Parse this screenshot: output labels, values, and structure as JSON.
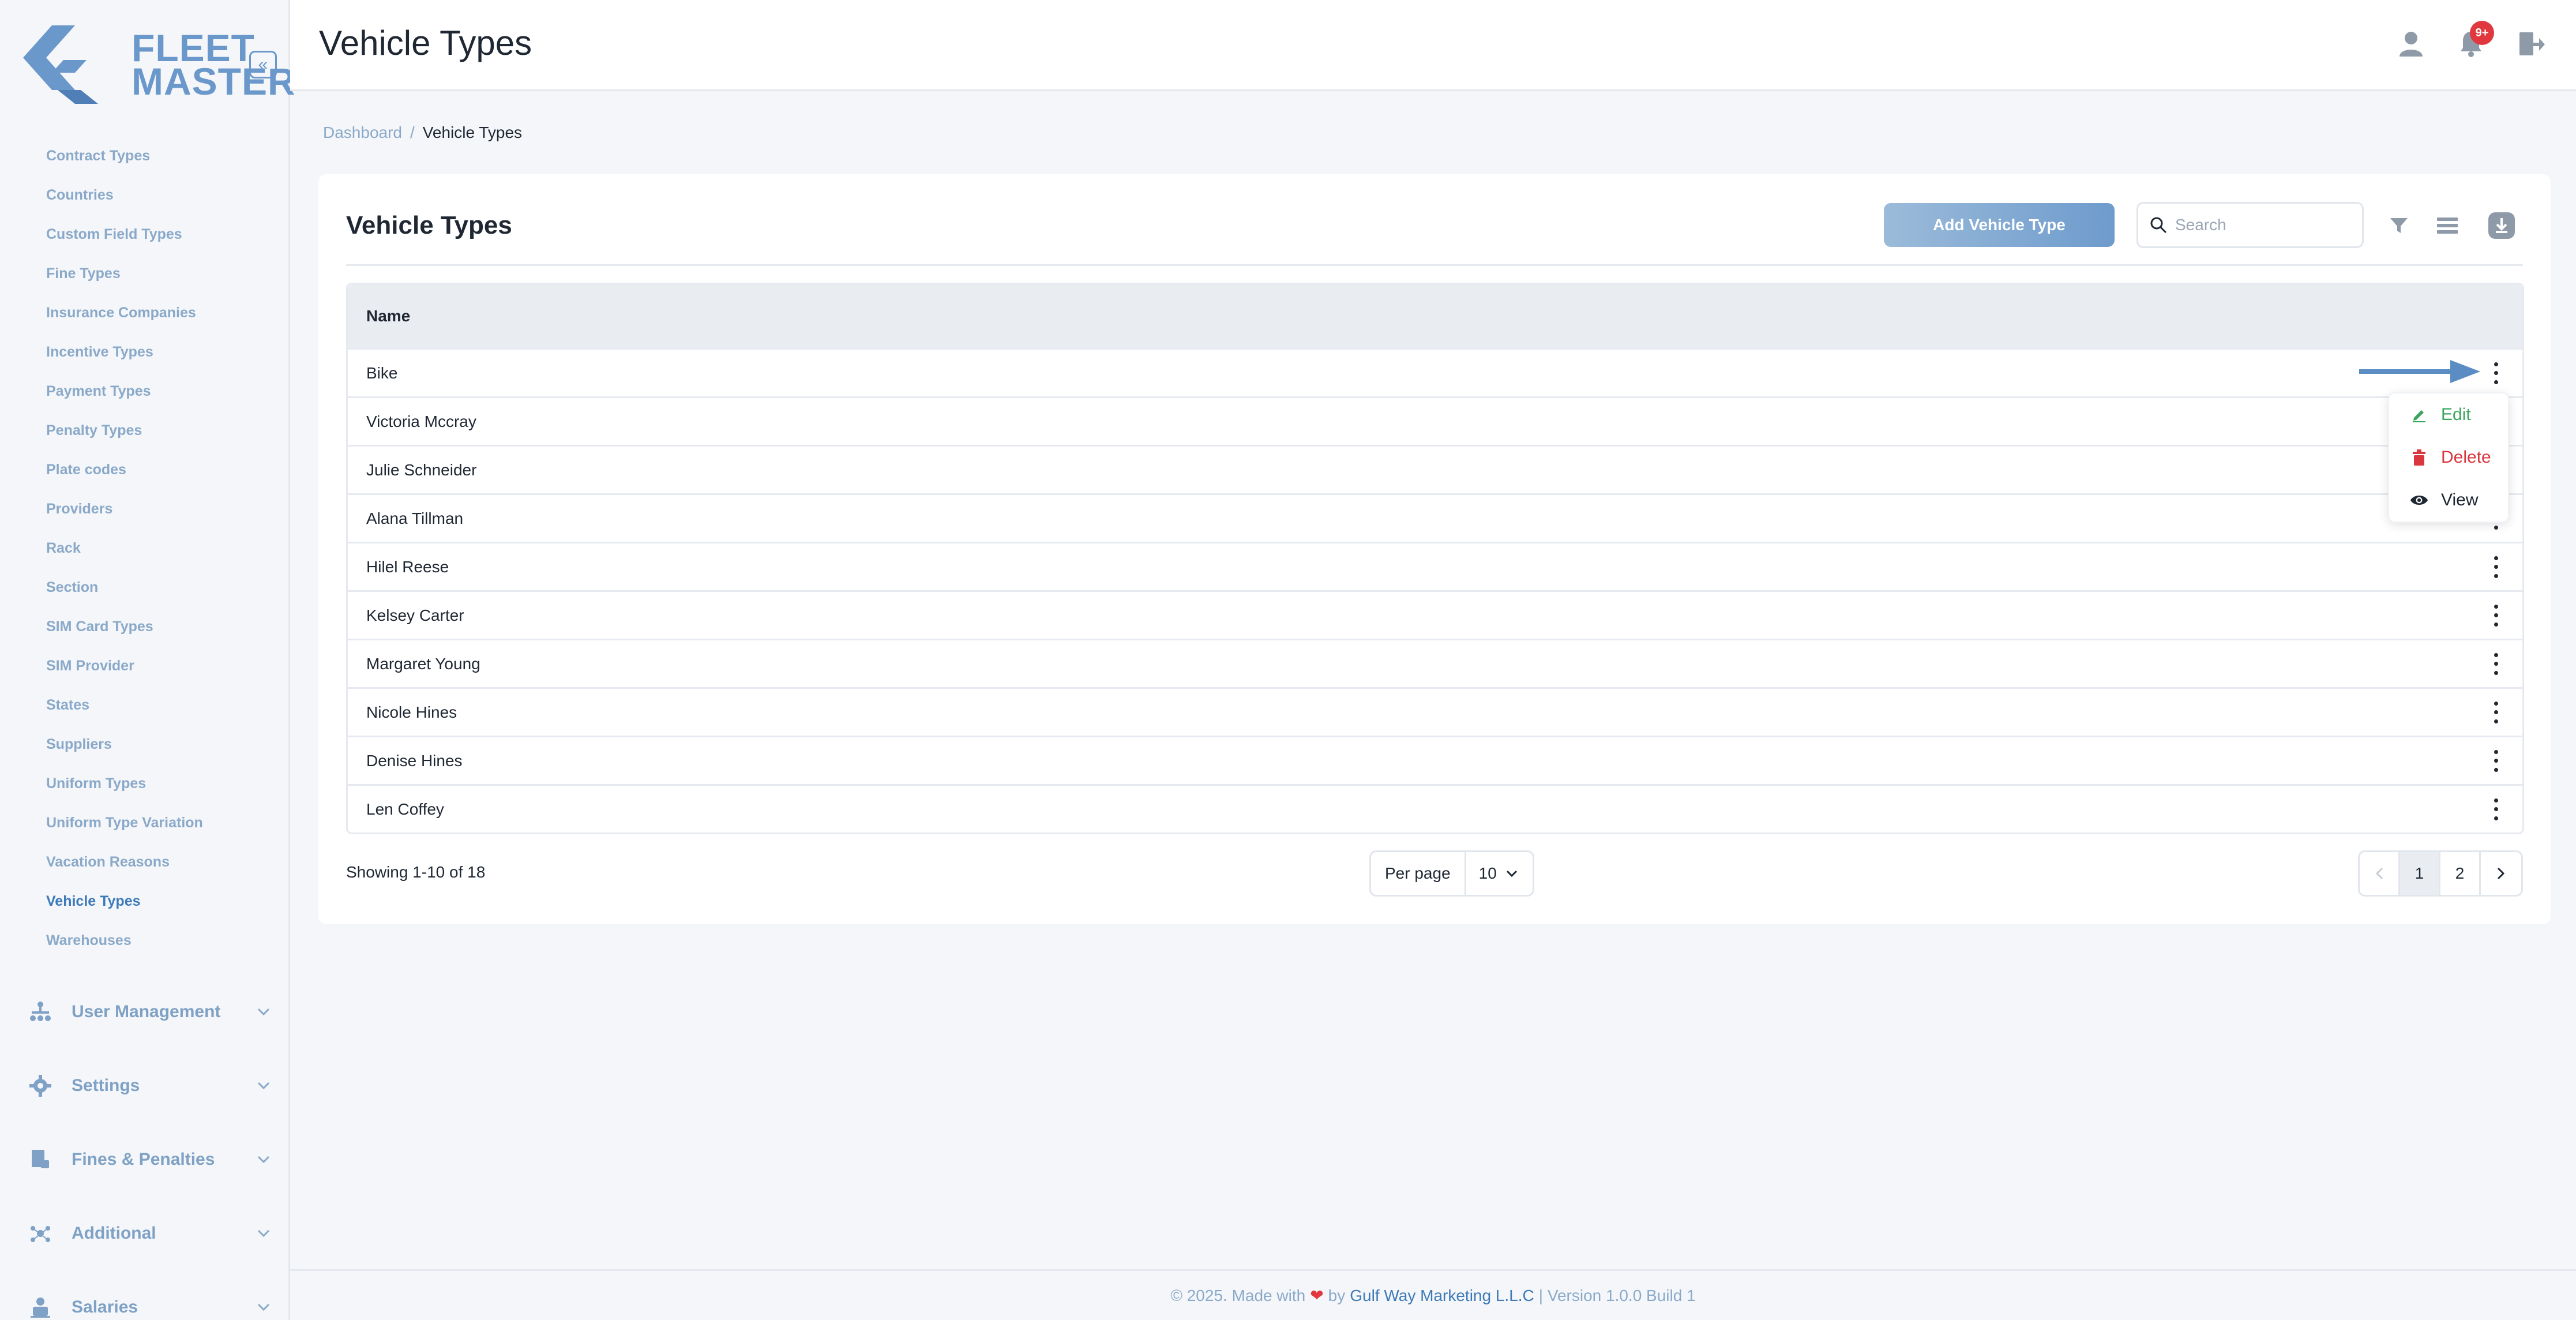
{
  "brand": {
    "line1": "FLEET",
    "line2": "MASTER",
    "accent": "#6a98cb"
  },
  "sidebar": {
    "collapse_glyph": "«",
    "items": [
      {
        "label": "Contract Types",
        "active": false
      },
      {
        "label": "Countries",
        "active": false
      },
      {
        "label": "Custom Field Types",
        "active": false
      },
      {
        "label": "Fine Types",
        "active": false
      },
      {
        "label": "Insurance Companies",
        "active": false
      },
      {
        "label": "Incentive Types",
        "active": false
      },
      {
        "label": "Payment Types",
        "active": false
      },
      {
        "label": "Penalty Types",
        "active": false
      },
      {
        "label": "Plate codes",
        "active": false
      },
      {
        "label": "Providers",
        "active": false
      },
      {
        "label": "Rack",
        "active": false
      },
      {
        "label": "Section",
        "active": false
      },
      {
        "label": "SIM Card Types",
        "active": false
      },
      {
        "label": "SIM Provider",
        "active": false
      },
      {
        "label": "States",
        "active": false
      },
      {
        "label": "Suppliers",
        "active": false
      },
      {
        "label": "Uniform Types",
        "active": false
      },
      {
        "label": "Uniform Type Variation",
        "active": false
      },
      {
        "label": "Vacation Reasons",
        "active": false
      },
      {
        "label": "Vehicle Types",
        "active": true
      },
      {
        "label": "Warehouses",
        "active": false
      }
    ],
    "groups": [
      {
        "label": "User Management",
        "icon": "org-chart-icon"
      },
      {
        "label": "Settings",
        "icon": "gear-icon"
      },
      {
        "label": "Fines & Penalties",
        "icon": "ticket-icon"
      },
      {
        "label": "Additional",
        "icon": "network-icon"
      },
      {
        "label": "Salaries",
        "icon": "salary-icon"
      }
    ]
  },
  "header": {
    "title": "Vehicle Types",
    "notification_badge": "9+",
    "icons": [
      "user-icon",
      "bell-icon",
      "logout-icon"
    ]
  },
  "breadcrumb": {
    "home": "Dashboard",
    "separator": "/",
    "current": "Vehicle Types"
  },
  "card": {
    "title": "Vehicle Types",
    "add_button": "Add Vehicle Type",
    "search_placeholder": "Search",
    "tools": [
      "filter-icon",
      "columns-icon",
      "download-icon"
    ]
  },
  "table": {
    "columns": [
      "Name"
    ],
    "rows": [
      "Bike",
      "Victoria Mccray",
      "Julie Schneider",
      "Alana Tillman",
      "Hilel Reese",
      "Kelsey Carter",
      "Margaret Young",
      "Nicole Hines",
      "Denise Hines",
      "Len Coffey"
    ]
  },
  "row_menu": {
    "items": [
      {
        "label": "Edit",
        "icon": "pencil-icon",
        "color": "#3aa55d"
      },
      {
        "label": "Delete",
        "icon": "trash-icon",
        "color": "#d9363e"
      },
      {
        "label": "View",
        "icon": "eye-icon",
        "color": "#1f2733"
      }
    ]
  },
  "pagination": {
    "showing": "Showing 1-10 of 18",
    "per_page_label": "Per page",
    "per_page_value": "10",
    "pages": [
      "1",
      "2"
    ],
    "current_page": "1"
  },
  "footer": {
    "prefix": "© 2025. Made with",
    "heart": "❤",
    "by": "by",
    "company": "Gulf Way Marketing L.L.C",
    "suffix": "| Version 1.0.0 Build 1"
  }
}
